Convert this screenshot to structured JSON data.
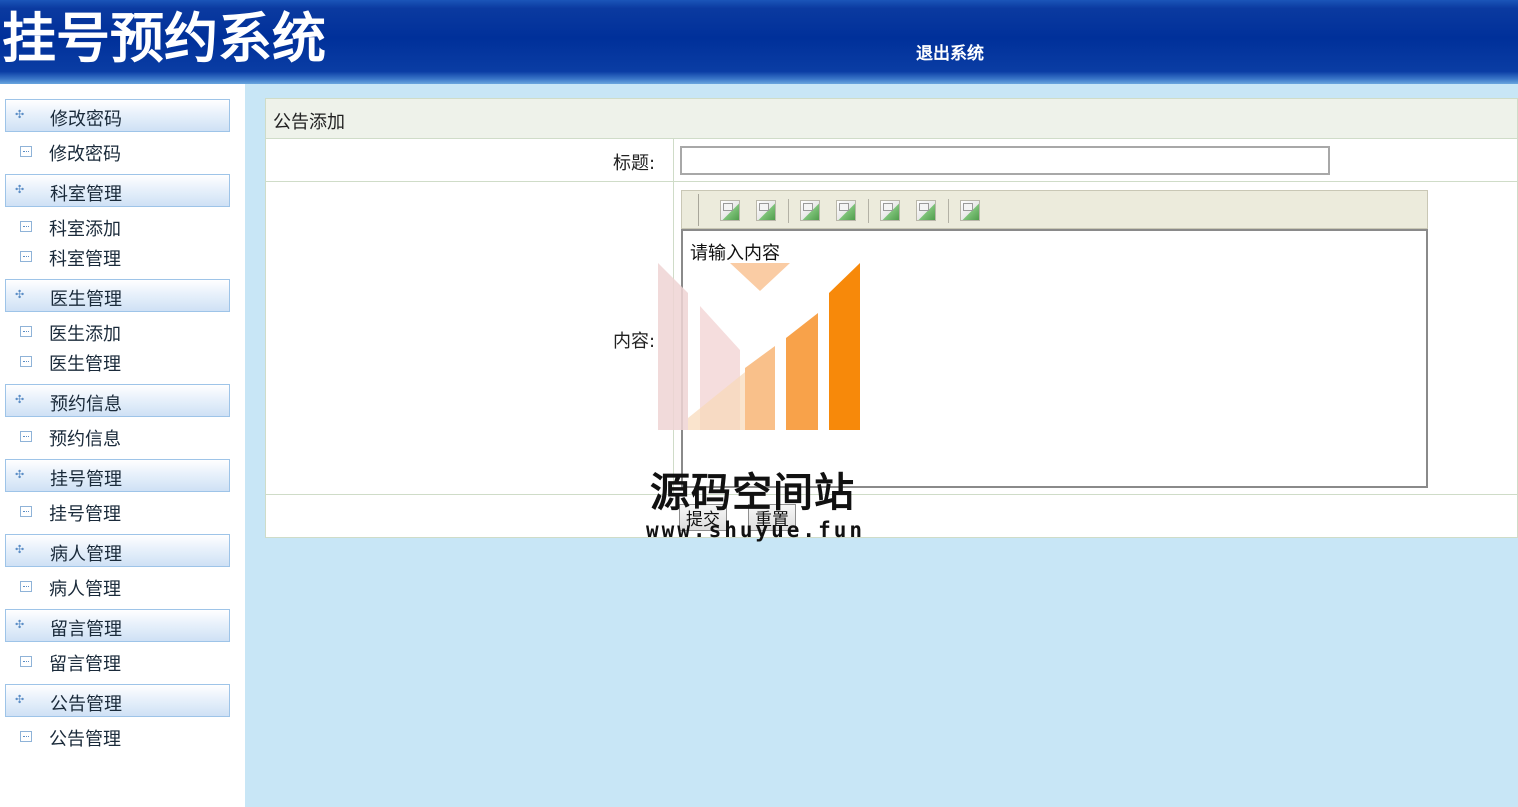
{
  "header": {
    "app_title": "挂号预约系统",
    "logout_label": "退出系统"
  },
  "sidebar": {
    "groups": [
      {
        "label": "修改密码",
        "items": [
          "修改密码"
        ]
      },
      {
        "label": "科室管理",
        "items": [
          "科室添加",
          "科室管理"
        ]
      },
      {
        "label": "医生管理",
        "items": [
          "医生添加",
          "医生管理"
        ]
      },
      {
        "label": "预约信息",
        "items": [
          "预约信息"
        ]
      },
      {
        "label": "挂号管理",
        "items": [
          "挂号管理"
        ]
      },
      {
        "label": "病人管理",
        "items": [
          "病人管理"
        ]
      },
      {
        "label": "留言管理",
        "items": [
          "留言管理"
        ]
      },
      {
        "label": "公告管理",
        "items": [
          "公告管理"
        ]
      }
    ]
  },
  "main": {
    "panel_title": "公告添加",
    "title_label": "标题:",
    "title_value": "",
    "content_label": "内容:",
    "content_placeholder": "请输入内容",
    "submit_label": "提交",
    "reset_label": "重置"
  },
  "watermark": {
    "text": "源码空间站",
    "url": "www.shuyue.fun"
  },
  "colors": {
    "header_blue": "#00309a",
    "page_bg": "#c8e6f6",
    "logo_orange": "#f7890a"
  }
}
